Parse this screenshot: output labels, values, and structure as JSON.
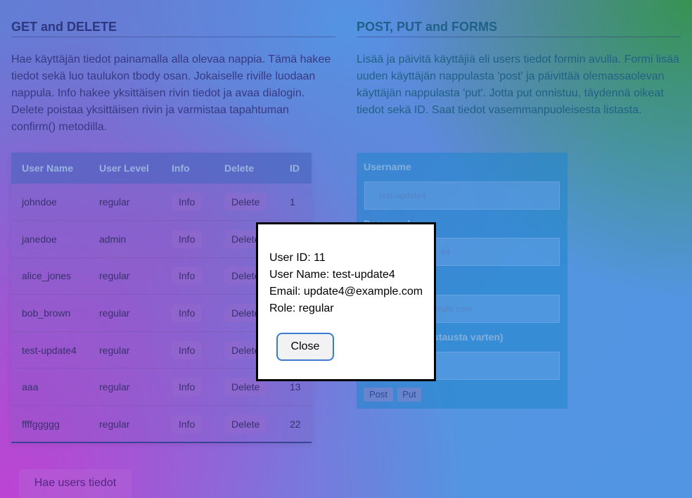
{
  "left": {
    "heading": "GET and DELETE",
    "description": "Hae käyttäjän tiedot painamalla alla olevaa nappia. Tämä hakee tiedot sekä luo taulukon tbody osan. Jokaiselle riville luodaan nappula. Info hakee yksittäisen rivin tiedot ja avaa dialogin. Delete poistaa yksittäisen rivin ja varmistaa tapahtuman confirm() metodilla."
  },
  "right": {
    "heading": "POST, PUT and FORMS",
    "description": "Lisää ja päivitä käyttäjiä eli users tiedot formin avulla. Formi lisää uuden käyttäjän nappulasta 'post' ja päivittää olemassaolevan käyttäjän nappulasta 'put'. Jotta put onnistuu, täydennä oikeat tiedot sekä ID. Saat tiedot vasemmanpuoleisesta listasta."
  },
  "table": {
    "headers": [
      "User Name",
      "User Level",
      "Info",
      "Delete",
      "ID"
    ],
    "info_label": "Info",
    "delete_label": "Delete",
    "rows": [
      {
        "name": "johndoe",
        "level": "regular",
        "id": "1"
      },
      {
        "name": "janedoe",
        "level": "admin",
        "id": ""
      },
      {
        "name": "alice_jones",
        "level": "regular",
        "id": ""
      },
      {
        "name": "bob_brown",
        "level": "regular",
        "id": ""
      },
      {
        "name": "test-update4",
        "level": "regular",
        "id": ""
      },
      {
        "name": "aaa",
        "level": "regular",
        "id": "13"
      },
      {
        "name": "ffffggggg",
        "level": "regular",
        "id": "22"
      }
    ]
  },
  "fetch_button": "Hae users tiedot",
  "form": {
    "username_label": "Username",
    "username_value": "test-update4",
    "password_label": "Password",
    "password_value": "e4",
    "email_value": "mple.com",
    "id_label_partial": "stausta varten)",
    "post_label": "Post",
    "put_label": "Put"
  },
  "dialog": {
    "user_id": "User ID: 11",
    "user_name": "User Name: test-update4",
    "email": "Email: update4@example.com",
    "role": "Role: regular",
    "close_label": "Close"
  }
}
